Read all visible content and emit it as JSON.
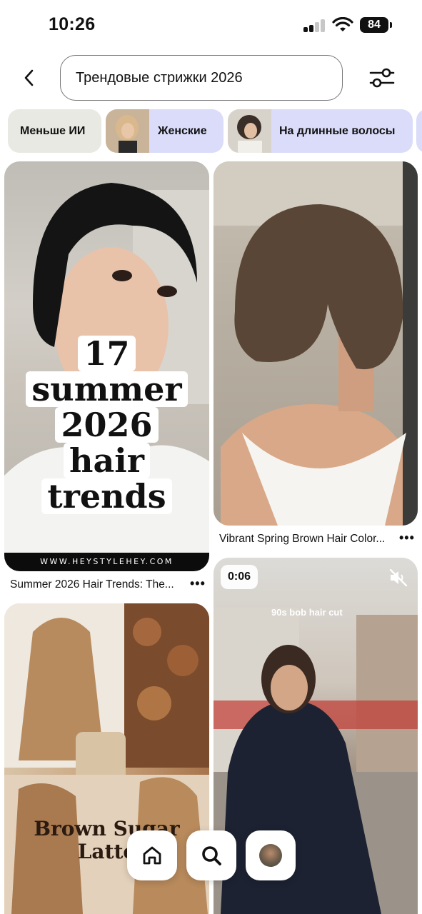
{
  "status_bar": {
    "time": "10:26",
    "battery": "84"
  },
  "search": {
    "query": "Трендовые стрижки 2026"
  },
  "chips": [
    {
      "label": "Меньше ИИ"
    },
    {
      "label": "Женские"
    },
    {
      "label": "На длинные волосы"
    }
  ],
  "pins": [
    {
      "caption": "Summer 2026 Hair Trends: The...",
      "overlay_lines": [
        "17",
        "summer",
        "2026",
        "hair",
        "trends"
      ],
      "watermark": "WWW.HEYSTYLEHEY.COM"
    },
    {
      "caption": "Vibrant Spring Brown Hair Color..."
    },
    {
      "overlay_text": "Brown Sugar Latte"
    },
    {
      "video_duration": "0:06",
      "overlay_text": "90s bob hair cut"
    }
  ],
  "more_label": "•••",
  "icons": {
    "back": "chevron-left-icon",
    "filter": "sliders-icon",
    "home": "home-icon",
    "search": "search-icon",
    "mute": "muted-speaker-icon"
  },
  "colors": {
    "chip_neutral": "#e9e9e4",
    "chip_accent": "#dadcfa"
  }
}
